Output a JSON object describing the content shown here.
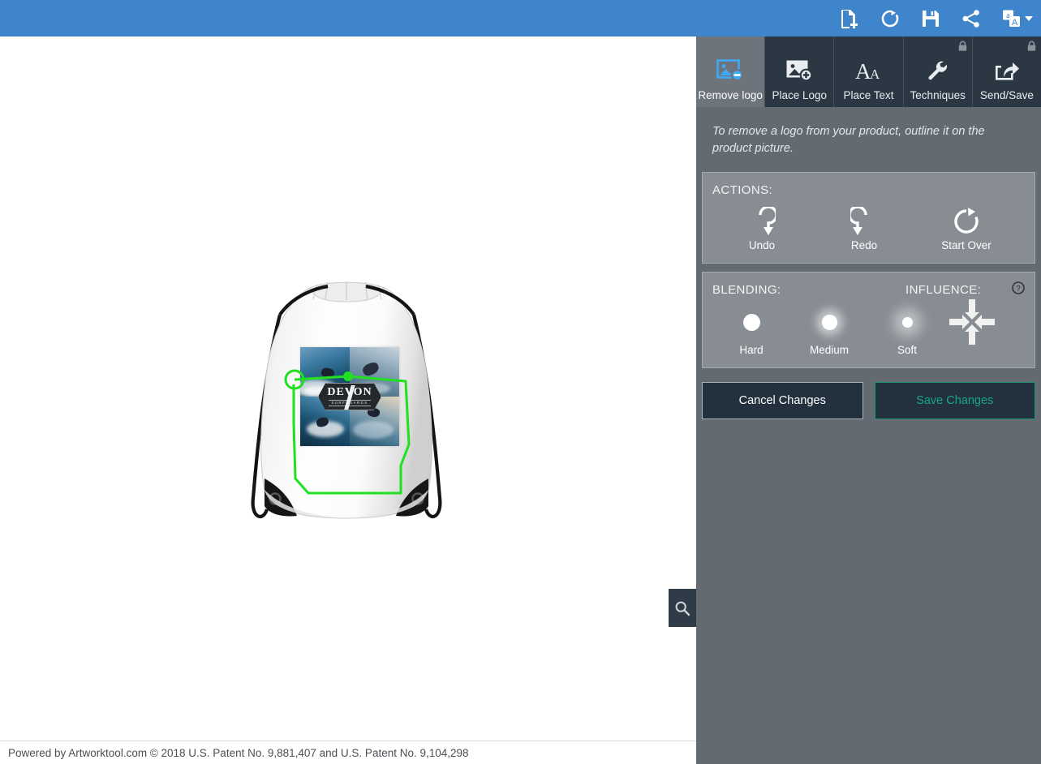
{
  "topbar": {
    "background": "#3e85cb",
    "icons": [
      {
        "name": "new-image-icon",
        "title": "New image"
      },
      {
        "name": "refresh-icon",
        "title": "Refresh"
      },
      {
        "name": "save-icon",
        "title": "Save"
      },
      {
        "name": "share-icon",
        "title": "Share"
      },
      {
        "name": "translate-icon",
        "title": "Language"
      }
    ]
  },
  "tabs": [
    {
      "label": "Remove logo",
      "icon": "image-remove-icon",
      "active": true,
      "locked": false
    },
    {
      "label": "Place Logo",
      "icon": "image-add-icon",
      "active": false,
      "locked": false
    },
    {
      "label": "Place Text",
      "icon": "text-aa-icon",
      "active": false,
      "locked": false
    },
    {
      "label": "Techniques",
      "icon": "wrench-icon",
      "active": false,
      "locked": true
    },
    {
      "label": "Send/Save",
      "icon": "share-export-icon",
      "active": false,
      "locked": true
    }
  ],
  "instruction": "To remove a logo from your product, outline it on the product picture.",
  "actions": {
    "title": "ACTIONS:",
    "items": [
      {
        "label": "Undo",
        "icon": "undo-arrow-icon"
      },
      {
        "label": "Redo",
        "icon": "redo-arrow-icon"
      },
      {
        "label": "Start Over",
        "icon": "restart-circle-icon"
      }
    ]
  },
  "blending": {
    "title": "BLENDING:",
    "options": [
      {
        "label": "Hard",
        "selected": false
      },
      {
        "label": "Medium",
        "selected": false
      },
      {
        "label": "Soft",
        "selected": false
      }
    ]
  },
  "influence": {
    "title": "INFLUENCE:",
    "icon": "converging-arrows-icon",
    "help_icon": "help-question-icon"
  },
  "buttons": {
    "cancel_label": "Cancel Changes",
    "save_label": "Save Changes",
    "save_color": "#1aa684",
    "cancel_border": "#aeb3b7"
  },
  "canvas": {
    "zoom_button_icon": "magnifier-icon",
    "product": {
      "name": "white-drawstring-bag",
      "artwork_brand": "DEVON",
      "artwork_subtitle": "SURFBOARDS"
    },
    "selection": {
      "color": "#20e020",
      "type": "polygon-outline",
      "closed": true
    }
  },
  "footer": {
    "text": "Powered by Artworktool.com © 2018 U.S. Patent No. 9,881,407 and U.S. Patent No. 9,104,298"
  },
  "colors": {
    "header_blue": "#3e85cb",
    "sidebar_gray": "#636a72",
    "panel_gray": "#878d93",
    "tab_dark": "#2b3844",
    "tab_active": "#6d747b"
  }
}
